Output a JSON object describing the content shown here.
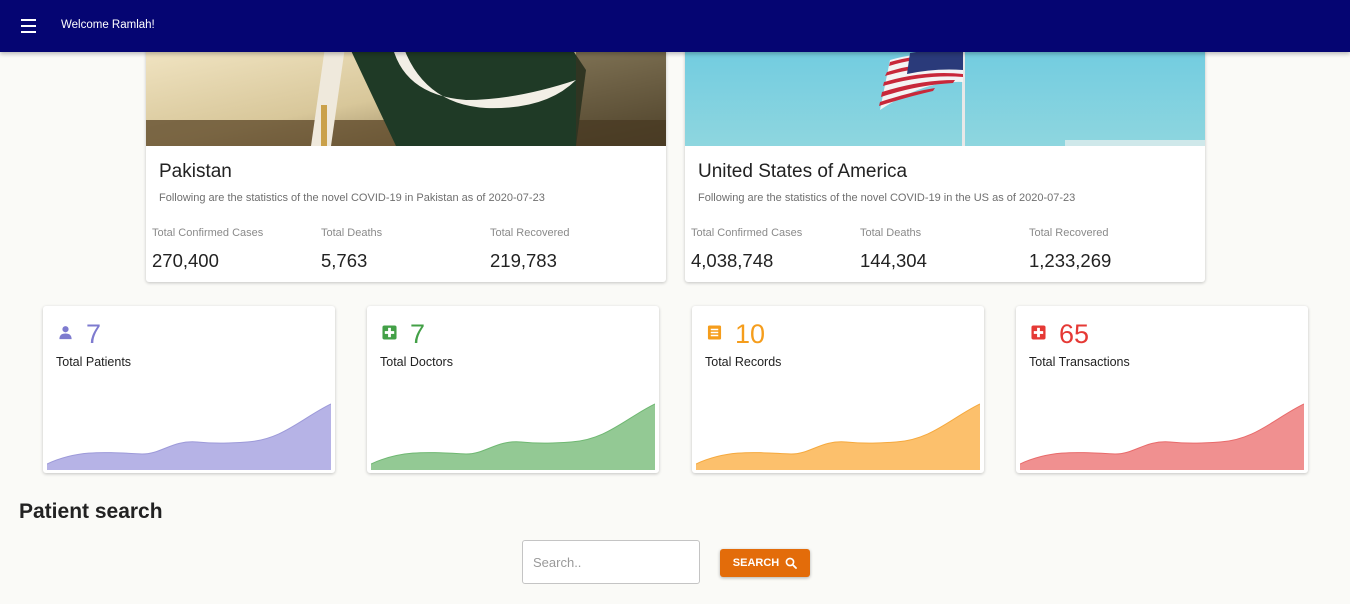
{
  "header": {
    "welcome": "Welcome Ramlah!"
  },
  "countries": [
    {
      "name": "Pakistan",
      "description": "Following are the statistics of the novel COVID-19 in Pakistan as of 2020-07-23",
      "stats": [
        {
          "label": "Total Confirmed Cases",
          "value": "270,400"
        },
        {
          "label": "Total Deaths",
          "value": "5,763"
        },
        {
          "label": "Total Recovered",
          "value": "219,783"
        }
      ]
    },
    {
      "name": "United States of America",
      "description": "Following are the statistics of the novel COVID-19 in the US as of 2020-07-23",
      "stats": [
        {
          "label": "Total Confirmed Cases",
          "value": "4,038,748"
        },
        {
          "label": "Total Deaths",
          "value": "144,304"
        },
        {
          "label": "Total Recovered",
          "value": "1,233,269"
        }
      ]
    }
  ],
  "metrics": [
    {
      "count": "7",
      "label": "Total Patients",
      "icon": "person-icon",
      "color": "#7e7bcf",
      "fill": "#b6b3e6"
    },
    {
      "count": "7",
      "label": "Total Doctors",
      "icon": "medical-plus-icon",
      "color": "#43a047",
      "fill": "#93c994"
    },
    {
      "count": "10",
      "label": "Total Records",
      "icon": "document-list-icon",
      "color": "#f59d1c",
      "fill": "#fcc06c"
    },
    {
      "count": "65",
      "label": "Total Transactions",
      "icon": "hospital-plus-icon",
      "color": "#e53935",
      "fill": "#f09090"
    }
  ],
  "search": {
    "title": "Patient search",
    "placeholder": "Search..",
    "button_label": "SEARCH"
  },
  "colors": {
    "appbar": "#050572",
    "accent": "#e36c0a"
  }
}
